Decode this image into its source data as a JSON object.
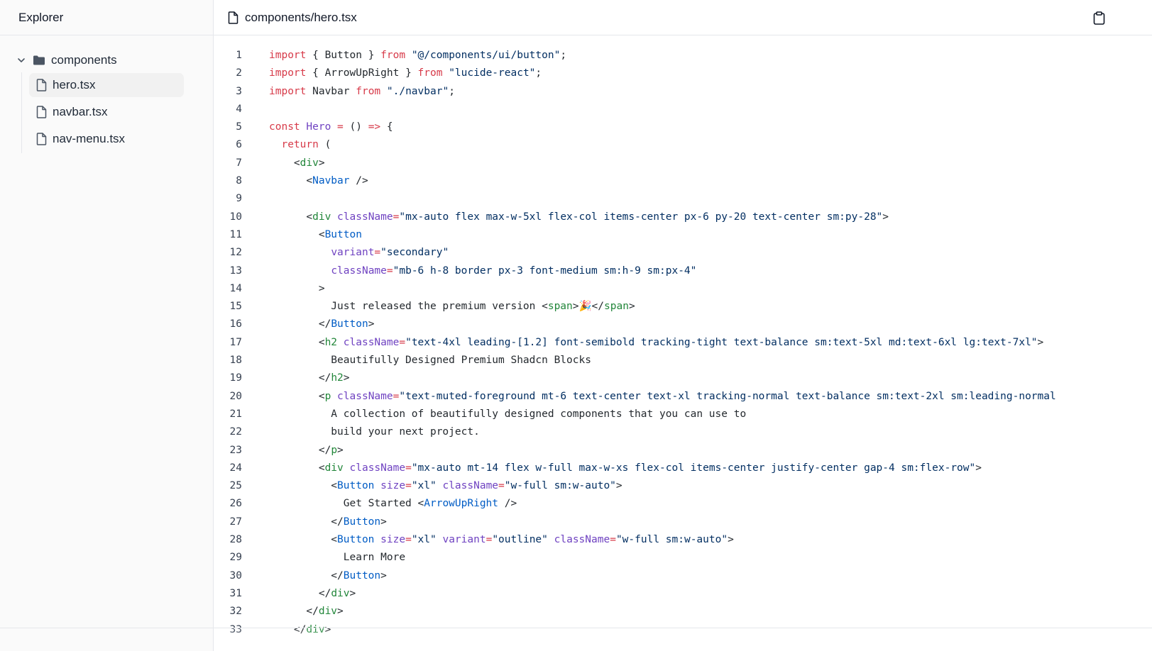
{
  "sidebar": {
    "title": "Explorer",
    "folder": {
      "label": "components",
      "files": [
        {
          "label": "hero.tsx",
          "active": true
        },
        {
          "label": "navbar.tsx",
          "active": false
        },
        {
          "label": "nav-menu.tsx",
          "active": false
        }
      ]
    }
  },
  "editor": {
    "path": "components/hero.tsx",
    "lines": [
      [
        [
          "kw",
          "import"
        ],
        [
          "p",
          " { Button } "
        ],
        [
          "kw",
          "from"
        ],
        [
          "p",
          " "
        ],
        [
          "str",
          "\"@/components/ui/button\""
        ],
        [
          "p",
          ";"
        ]
      ],
      [
        [
          "kw",
          "import"
        ],
        [
          "p",
          " { ArrowUpRight } "
        ],
        [
          "kw",
          "from"
        ],
        [
          "p",
          " "
        ],
        [
          "str",
          "\"lucide-react\""
        ],
        [
          "p",
          ";"
        ]
      ],
      [
        [
          "kw",
          "import"
        ],
        [
          "p",
          " Navbar "
        ],
        [
          "kw",
          "from"
        ],
        [
          "p",
          " "
        ],
        [
          "str",
          "\"./navbar\""
        ],
        [
          "p",
          ";"
        ]
      ],
      [],
      [
        [
          "kw",
          "const"
        ],
        [
          "p",
          " "
        ],
        [
          "fn",
          "Hero"
        ],
        [
          "p",
          " "
        ],
        [
          "op",
          "="
        ],
        [
          "p",
          " () "
        ],
        [
          "op",
          "=>"
        ],
        [
          "p",
          " {"
        ]
      ],
      [
        [
          "p",
          "  "
        ],
        [
          "kw",
          "return"
        ],
        [
          "p",
          " ("
        ]
      ],
      [
        [
          "p",
          "    <"
        ],
        [
          "tag",
          "div"
        ],
        [
          "p",
          ">"
        ]
      ],
      [
        [
          "p",
          "      <"
        ],
        [
          "comp",
          "Navbar"
        ],
        [
          "p",
          " />"
        ]
      ],
      [],
      [
        [
          "p",
          "      <"
        ],
        [
          "tag",
          "div"
        ],
        [
          "p",
          " "
        ],
        [
          "attr",
          "className"
        ],
        [
          "op",
          "="
        ],
        [
          "str",
          "\"mx-auto flex max-w-5xl flex-col items-center px-6 py-20 text-center sm:py-28\""
        ],
        [
          "p",
          ">"
        ]
      ],
      [
        [
          "p",
          "        <"
        ],
        [
          "comp",
          "Button"
        ]
      ],
      [
        [
          "p",
          "          "
        ],
        [
          "attr",
          "variant"
        ],
        [
          "op",
          "="
        ],
        [
          "str",
          "\"secondary\""
        ]
      ],
      [
        [
          "p",
          "          "
        ],
        [
          "attr",
          "className"
        ],
        [
          "op",
          "="
        ],
        [
          "str",
          "\"mb-6 h-8 border px-3 font-medium sm:h-9 sm:px-4\""
        ]
      ],
      [
        [
          "p",
          "        >"
        ]
      ],
      [
        [
          "p",
          "          Just released the premium version <"
        ],
        [
          "tag",
          "span"
        ],
        [
          "p",
          ">🎉</"
        ],
        [
          "tag",
          "span"
        ],
        [
          "p",
          ">"
        ]
      ],
      [
        [
          "p",
          "        </"
        ],
        [
          "comp",
          "Button"
        ],
        [
          "p",
          ">"
        ]
      ],
      [
        [
          "p",
          "        <"
        ],
        [
          "tag",
          "h2"
        ],
        [
          "p",
          " "
        ],
        [
          "attr",
          "className"
        ],
        [
          "op",
          "="
        ],
        [
          "str",
          "\"text-4xl leading-[1.2] font-semibold tracking-tight text-balance sm:text-5xl md:text-6xl lg:text-7xl\""
        ],
        [
          "p",
          ">"
        ]
      ],
      [
        [
          "p",
          "          Beautifully Designed Premium Shadcn Blocks"
        ]
      ],
      [
        [
          "p",
          "        </"
        ],
        [
          "tag",
          "h2"
        ],
        [
          "p",
          ">"
        ]
      ],
      [
        [
          "p",
          "        <"
        ],
        [
          "tag",
          "p"
        ],
        [
          "p",
          " "
        ],
        [
          "attr",
          "className"
        ],
        [
          "op",
          "="
        ],
        [
          "str",
          "\"text-muted-foreground mt-6 text-center text-xl tracking-normal text-balance sm:text-2xl sm:leading-normal"
        ]
      ],
      [
        [
          "p",
          "          A collection of beautifully designed components that you can use to"
        ]
      ],
      [
        [
          "p",
          "          build your next project."
        ]
      ],
      [
        [
          "p",
          "        </"
        ],
        [
          "tag",
          "p"
        ],
        [
          "p",
          ">"
        ]
      ],
      [
        [
          "p",
          "        <"
        ],
        [
          "tag",
          "div"
        ],
        [
          "p",
          " "
        ],
        [
          "attr",
          "className"
        ],
        [
          "op",
          "="
        ],
        [
          "str",
          "\"mx-auto mt-14 flex w-full max-w-xs flex-col items-center justify-center gap-4 sm:flex-row\""
        ],
        [
          "p",
          ">"
        ]
      ],
      [
        [
          "p",
          "          <"
        ],
        [
          "comp",
          "Button"
        ],
        [
          "p",
          " "
        ],
        [
          "attr",
          "size"
        ],
        [
          "op",
          "="
        ],
        [
          "str",
          "\"xl\""
        ],
        [
          "p",
          " "
        ],
        [
          "attr",
          "className"
        ],
        [
          "op",
          "="
        ],
        [
          "str",
          "\"w-full sm:w-auto\""
        ],
        [
          "p",
          ">"
        ]
      ],
      [
        [
          "p",
          "            Get Started <"
        ],
        [
          "comp",
          "ArrowUpRight"
        ],
        [
          "p",
          " />"
        ]
      ],
      [
        [
          "p",
          "          </"
        ],
        [
          "comp",
          "Button"
        ],
        [
          "p",
          ">"
        ]
      ],
      [
        [
          "p",
          "          <"
        ],
        [
          "comp",
          "Button"
        ],
        [
          "p",
          " "
        ],
        [
          "attr",
          "size"
        ],
        [
          "op",
          "="
        ],
        [
          "str",
          "\"xl\""
        ],
        [
          "p",
          " "
        ],
        [
          "attr",
          "variant"
        ],
        [
          "op",
          "="
        ],
        [
          "str",
          "\"outline\""
        ],
        [
          "p",
          " "
        ],
        [
          "attr",
          "className"
        ],
        [
          "op",
          "="
        ],
        [
          "str",
          "\"w-full sm:w-auto\""
        ],
        [
          "p",
          ">"
        ]
      ],
      [
        [
          "p",
          "            Learn More"
        ]
      ],
      [
        [
          "p",
          "          </"
        ],
        [
          "comp",
          "Button"
        ],
        [
          "p",
          ">"
        ]
      ],
      [
        [
          "p",
          "        </"
        ],
        [
          "tag",
          "div"
        ],
        [
          "p",
          ">"
        ]
      ],
      [
        [
          "p",
          "      </"
        ],
        [
          "tag",
          "div"
        ],
        [
          "p",
          ">"
        ]
      ],
      [
        [
          "p",
          "    </"
        ],
        [
          "tag",
          "div"
        ],
        [
          "p",
          ">"
        ]
      ]
    ]
  }
}
